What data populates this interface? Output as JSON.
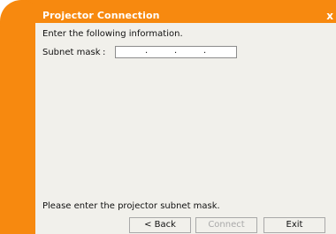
{
  "window": {
    "title": "Projector Connection",
    "close_glyph": "x",
    "accent_color": "#f7890f"
  },
  "form": {
    "intro": "Enter the following information.",
    "subnet_label": "Subnet mask",
    "colon": ":",
    "subnet_octets": [
      "",
      "",
      "",
      ""
    ],
    "separator": "."
  },
  "status": {
    "hint": "Please enter the projector subnet mask."
  },
  "buttons": {
    "back": "< Back",
    "connect": "Connect",
    "exit": "Exit"
  }
}
